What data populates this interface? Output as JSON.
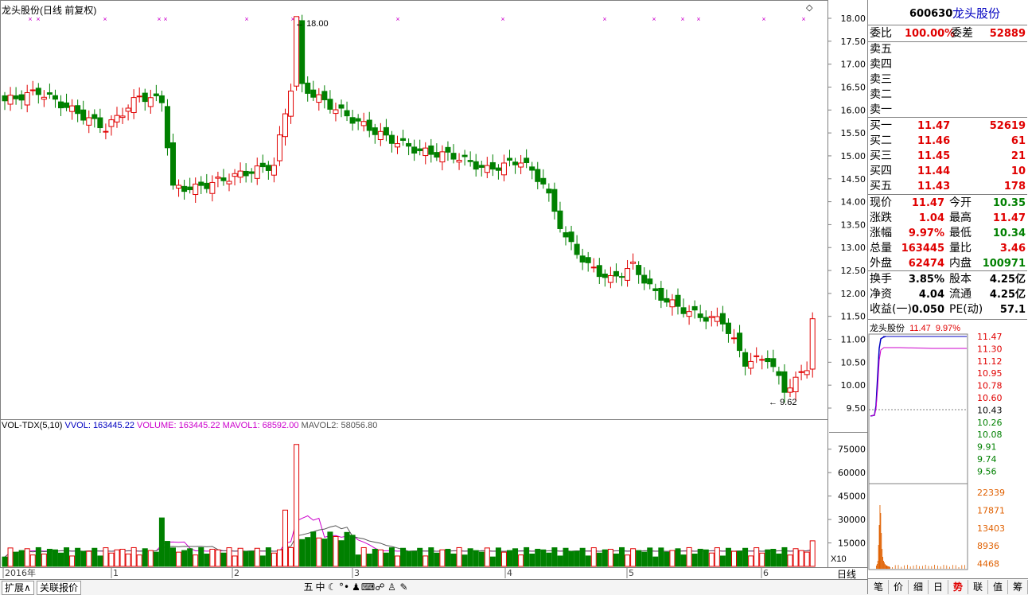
{
  "chart": {
    "title": "龙头股份(日线 前复权)",
    "price_ticks": [
      "18.00",
      "17.50",
      "17.00",
      "16.50",
      "16.00",
      "15.50",
      "15.00",
      "14.50",
      "14.00",
      "13.50",
      "13.00",
      "12.50",
      "12.00",
      "11.50",
      "11.00",
      "10.50",
      "10.00",
      "9.50"
    ],
    "high_label": "18.00",
    "low_label": "9.62",
    "marker_glyph": "×",
    "diamond_glyph": "◇",
    "up_color": "#e00000",
    "down_color": "#008000",
    "ma_color": "#cc00cc"
  },
  "volume": {
    "legend_name": "VOL-TDX(5,10)",
    "legend_vvol": "VVOL: 163445.22",
    "legend_volume": "VOLUME: 163445.22",
    "legend_mavol1": "MAVOL1: 68592.00",
    "legend_mavol2": "MAVOL2: 58056.80",
    "ticks": [
      "75000",
      "60000",
      "45000",
      "30000",
      "15000"
    ],
    "unit_label": "X10",
    "mavol1_color": "#cc00cc",
    "mavol2_color": "#555555"
  },
  "date_axis": {
    "labels": [
      "2016年",
      "1",
      "2",
      "3",
      "4",
      "5",
      "6"
    ],
    "period_label": "日线"
  },
  "bottom_bar": {
    "tab_expand": "扩展∧",
    "tab_related": "关联报价",
    "tools": [
      "五",
      "中",
      "☾",
      "°•",
      "♟",
      "⌨",
      "☍",
      "♙",
      "✎"
    ]
  },
  "quote": {
    "code": "600630",
    "name": "龙头股份",
    "weibi_label": "委比",
    "weibi_value": "100.00%",
    "weicha_label": "委差",
    "weicha_value": "52889",
    "sells": [
      {
        "label": "卖五",
        "price": "",
        "vol": ""
      },
      {
        "label": "卖四",
        "price": "",
        "vol": ""
      },
      {
        "label": "卖三",
        "price": "",
        "vol": ""
      },
      {
        "label": "卖二",
        "price": "",
        "vol": ""
      },
      {
        "label": "卖一",
        "price": "",
        "vol": ""
      }
    ],
    "buys": [
      {
        "label": "买一",
        "price": "11.47",
        "vol": "52619"
      },
      {
        "label": "买二",
        "price": "11.46",
        "vol": "61"
      },
      {
        "label": "买三",
        "price": "11.45",
        "vol": "21"
      },
      {
        "label": "买四",
        "price": "11.44",
        "vol": "10"
      },
      {
        "label": "买五",
        "price": "11.43",
        "vol": "178"
      }
    ],
    "stats": [
      {
        "l1": "现价",
        "v1": "11.47",
        "c1": "red",
        "l2": "今开",
        "v2": "10.35",
        "c2": "green"
      },
      {
        "l1": "涨跌",
        "v1": "1.04",
        "c1": "red",
        "l2": "最高",
        "v2": "11.47",
        "c2": "red"
      },
      {
        "l1": "涨幅",
        "v1": "9.97%",
        "c1": "red",
        "l2": "最低",
        "v2": "10.34",
        "c2": "green"
      },
      {
        "l1": "总量",
        "v1": "163445",
        "c1": "red",
        "l2": "量比",
        "v2": "3.46",
        "c2": "red"
      },
      {
        "l1": "外盘",
        "v1": "62474",
        "c1": "red",
        "l2": "内盘",
        "v2": "100971",
        "c2": "green"
      }
    ],
    "stats2": [
      {
        "l1": "换手",
        "v1": "3.85%",
        "l2": "股本",
        "v2": "4.25亿"
      },
      {
        "l1": "净资",
        "v1": "4.04",
        "l2": "流通",
        "v2": "4.25亿"
      },
      {
        "l1": "收益(一)",
        "v1": "0.050",
        "l2": "PE(动)",
        "v2": "57.1"
      }
    ]
  },
  "mini": {
    "name": "龙头股份",
    "price": "11.47",
    "pct": "9.97%",
    "price_ticks": [
      "11.47",
      "11.30",
      "11.12",
      "10.95",
      "10.78",
      "10.60",
      "10.43",
      "10.26",
      "10.08",
      "9.91",
      "9.74",
      "9.56"
    ],
    "vol_ticks": [
      "22339",
      "17871",
      "13403",
      "8936",
      "4468"
    ]
  },
  "right_tabs": [
    "笔",
    "价",
    "细",
    "日",
    "势",
    "联",
    "值",
    "筹"
  ],
  "active_right_tab": "势"
}
